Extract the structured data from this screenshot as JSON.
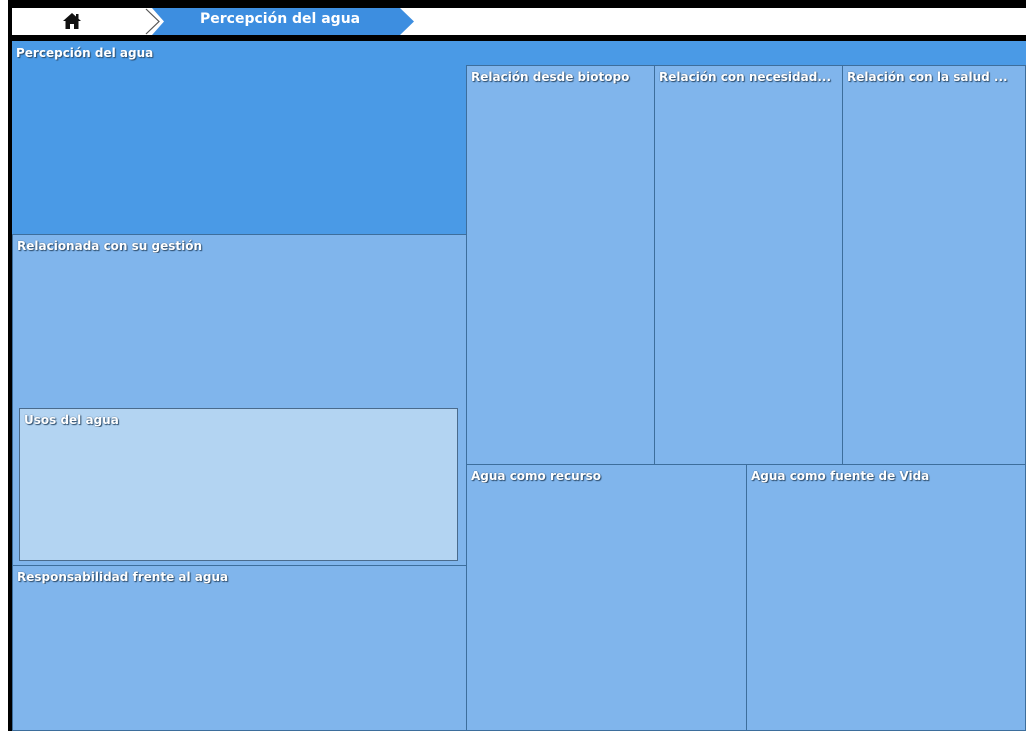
{
  "breadcrumb": {
    "home_icon": "home-icon",
    "current": "Percepción del agua"
  },
  "treemap": {
    "root": "Percepción del agua",
    "tiles": {
      "gestion": "Relacionada con su gestión",
      "usos": "Usos del agua",
      "responsabilidad": "Responsabilidad frente al agua",
      "biotopo": "Relación desde biotopo",
      "necesidad": "Relación con necesidad...",
      "salud": "Relación con la salud ...",
      "recurso": "Agua como recurso",
      "vida": "Agua como fuente de Vida"
    }
  },
  "colors": {
    "root": "#4a9ae6",
    "tile": "#80b5ec",
    "nested_tile": "#b3d4f2",
    "breadcrumb_active": "#3d8ee0"
  }
}
